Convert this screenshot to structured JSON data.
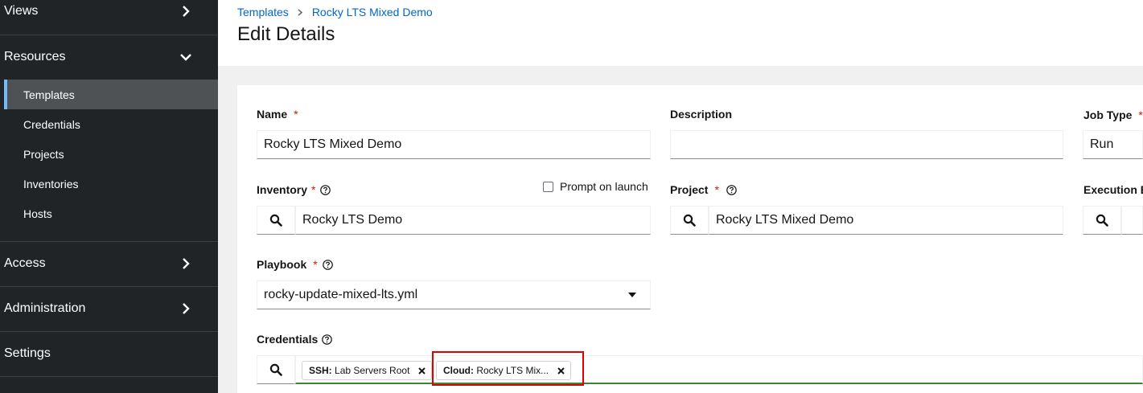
{
  "sidebar": {
    "groups": {
      "views": "Views",
      "resources": "Resources",
      "access": "Access",
      "administration": "Administration",
      "settings": "Settings"
    },
    "resources_items": [
      "Templates",
      "Credentials",
      "Projects",
      "Inventories",
      "Hosts"
    ],
    "active_item": "Templates",
    "active_color": "#73bcf7"
  },
  "header": {
    "breadcrumb": [
      "Templates",
      "Rocky LTS Mixed Demo"
    ],
    "title": "Edit Details"
  },
  "form": {
    "name": {
      "label": "Name",
      "value": "Rocky LTS Mixed Demo"
    },
    "description": {
      "label": "Description",
      "value": ""
    },
    "job_type": {
      "label": "Job Type",
      "value": "Run"
    },
    "inventory": {
      "label": "Inventory",
      "value": "Rocky LTS Demo",
      "prompt_label": "Prompt on launch"
    },
    "project": {
      "label": "Project",
      "value": "Rocky LTS Mixed Demo"
    },
    "execution_environment": {
      "label": "Execution E"
    },
    "playbook": {
      "label": "Playbook",
      "value": "rocky-update-mixed-lts.yml"
    },
    "credentials": {
      "label": "Credentials",
      "chips": [
        {
          "type": "SSH:",
          "name": "Lab Servers Root"
        },
        {
          "type": "Cloud:",
          "name": "Rocky LTS Mix..."
        }
      ]
    },
    "required_marker": "*"
  },
  "colors": {
    "link": "#0066cc",
    "required": "#c9190b",
    "highlight": "#e00000",
    "sidebar_bg": "#212427"
  }
}
